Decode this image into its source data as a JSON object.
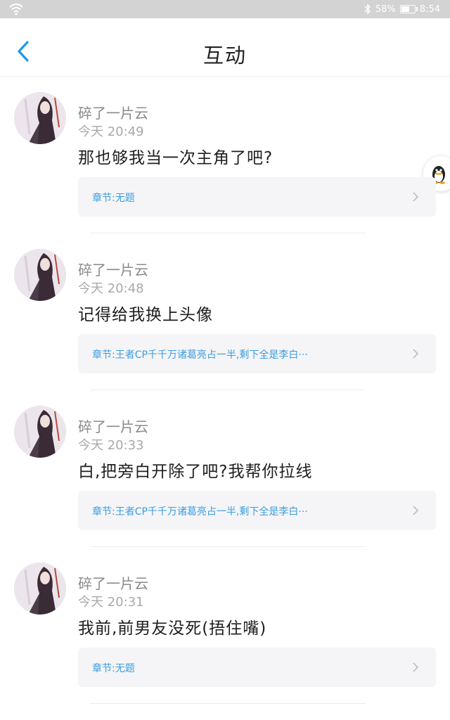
{
  "status_bar": {
    "battery": "58%",
    "battery_level": 0.58,
    "time": "8:54"
  },
  "header": {
    "title": "互动"
  },
  "comments": [
    {
      "name": "碎了一片云",
      "time": "今天 20:49",
      "text": "那也够我当一次主角了吧?",
      "chapter": "章节:无题"
    },
    {
      "name": "碎了一片云",
      "time": "今天 20:48",
      "text": "记得给我换上头像",
      "chapter": "章节:王者CP千千万诸葛亮占一半,剩下全是李白···"
    },
    {
      "name": "碎了一片云",
      "time": "今天 20:33",
      "text": "白,把旁白开除了吧?我帮你拉线",
      "chapter": "章节:王者CP千千万诸葛亮占一半,剩下全是李白···"
    },
    {
      "name": "碎了一片云",
      "time": "今天 20:31",
      "text": "我前,前男友没死(捂住嘴)",
      "chapter": "章节:无题"
    }
  ]
}
